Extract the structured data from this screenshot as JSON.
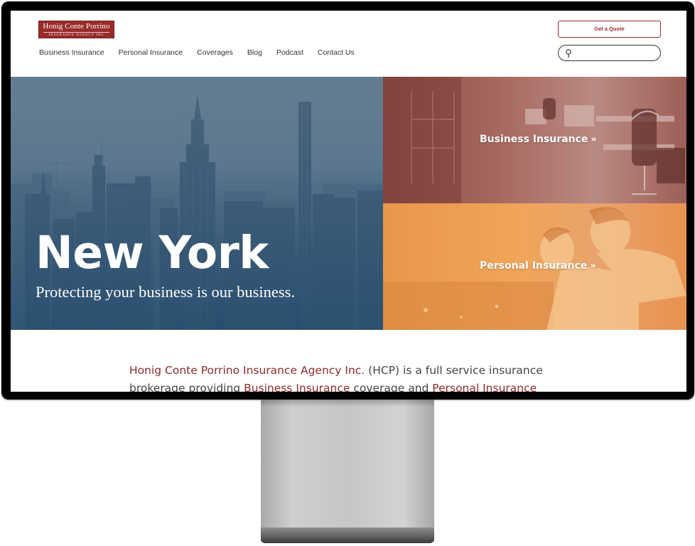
{
  "header": {
    "logo_name": "Honig Conte Porrino",
    "logo_sub": "INSURANCE AGENCY INC",
    "nav": [
      "Business Insurance",
      "Personal Insurance",
      "Coverages",
      "Blog",
      "Podcast",
      "Contact Us"
    ],
    "quote_button": "Get a Quote",
    "search_placeholder": ""
  },
  "hero": {
    "title": "New York",
    "subtitle": "Protecting your business is our business."
  },
  "tiles": {
    "business": "Business Insurance",
    "personal": "Personal Insurance",
    "chevron": "»"
  },
  "intro": {
    "company": "Honig Conte Porrino Insurance Agency Inc.",
    "part1": " (HCP) is a full service insurance brokerage providing ",
    "business_link": "Business Insurance",
    "part2": " coverage and ",
    "personal_link": "Personal Insurance"
  },
  "colors": {
    "brand": "#9a2b2b",
    "hero_blue": "#2f5677",
    "tile_business": "#a0605a",
    "tile_personal": "#ee9e55"
  },
  "icons": {
    "search": "search-icon"
  }
}
